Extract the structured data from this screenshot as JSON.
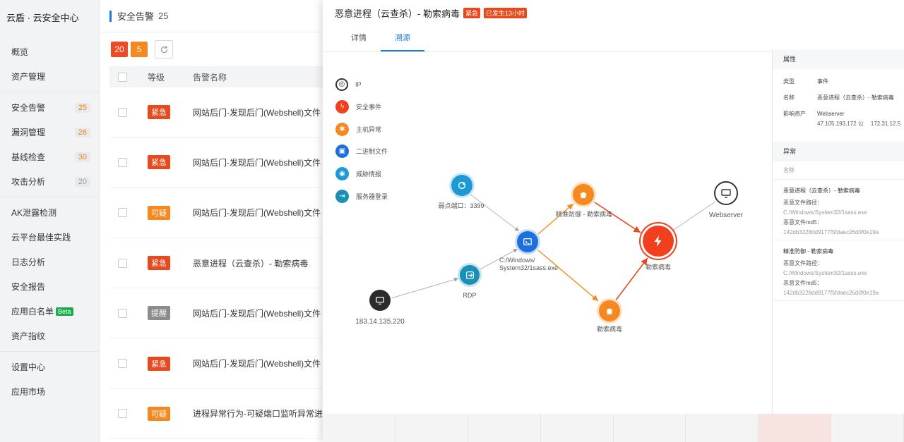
{
  "brand": "云盾 · 云安全中心",
  "nav": [
    [
      {
        "key": "overview",
        "label": "概览"
      },
      {
        "key": "assets",
        "label": "资产管理"
      }
    ],
    [
      {
        "key": "alerts",
        "label": "安全告警",
        "badge": "25"
      },
      {
        "key": "vulns",
        "label": "漏洞管理",
        "badge": "28"
      },
      {
        "key": "baseline",
        "label": "基线检查",
        "badge": "30"
      },
      {
        "key": "attack",
        "label": "攻击分析",
        "badge": "20",
        "badge_style": "gray"
      }
    ],
    [
      {
        "key": "ak",
        "label": "AK泄露检测"
      },
      {
        "key": "cloud-best",
        "label": "云平台最佳实践"
      },
      {
        "key": "logs",
        "label": "日志分析"
      },
      {
        "key": "report",
        "label": "安全报告"
      },
      {
        "key": "whitelist",
        "label": "应用白名单",
        "beta": "Beta"
      },
      {
        "key": "fingerprint",
        "label": "资产指纹"
      }
    ],
    [
      {
        "key": "settings",
        "label": "设置中心"
      },
      {
        "key": "market",
        "label": "应用市场"
      }
    ]
  ],
  "main": {
    "title": "安全告警",
    "count": "25",
    "chip_red": "20",
    "chip_orange": "5",
    "col_level": "等级",
    "col_name": "告警名称",
    "rows": [
      {
        "level": "紧急",
        "style": "urgent",
        "name": "网站后门-发现后门(Webshell)文件"
      },
      {
        "level": "紧急",
        "style": "urgent",
        "name": "网站后门-发现后门(Webshell)文件"
      },
      {
        "level": "可疑",
        "style": "suspect",
        "name": "网站后门-发现后门(Webshell)文件"
      },
      {
        "level": "紧急",
        "style": "urgent",
        "name": "恶意进程（云查杀）- 勒索病毒"
      },
      {
        "level": "提醒",
        "style": "notice",
        "name": "网站后门-发现后门(Webshell)文件"
      },
      {
        "level": "紧急",
        "style": "urgent",
        "name": "网站后门-发现后门(Webshell)文件"
      },
      {
        "level": "可疑",
        "style": "suspect",
        "name": "进程异常行为-可疑端口监听异常进程"
      }
    ]
  },
  "drawer": {
    "title": "恶意进程（云查杀）- 勒索病毒",
    "tag_urgent": "紧急",
    "tag_time": "已发生13小时",
    "tabs": [
      {
        "label": "详情"
      },
      {
        "label": "溯源",
        "active": true
      }
    ],
    "legend": [
      {
        "label": "IP",
        "style": "li-ip",
        "glyph": "◎"
      },
      {
        "label": "安全事件",
        "style": "li-event",
        "glyph": "ϟ"
      },
      {
        "label": "主机异常",
        "style": "li-host",
        "glyph": "✱"
      },
      {
        "label": "二进制文件",
        "style": "li-bin",
        "glyph": "▣"
      },
      {
        "label": "威胁情报",
        "style": "li-threat",
        "glyph": "◉"
      },
      {
        "label": "服务器登录",
        "style": "li-login",
        "glyph": "⇥"
      }
    ],
    "nodes": {
      "weak_port": "弱点端口：3399",
      "rdp": "RDP",
      "ip": "183.14.135.220",
      "binary_line1": "C:/Windows/",
      "binary_line2": "System32/1sass.exe",
      "precise": "精准防御 - 勒索病毒",
      "ransom_lower": "勒索病毒",
      "event": "勒索病毒",
      "webserver": "Webserver"
    }
  },
  "props": {
    "section_attr": "属性",
    "type_k": "类型",
    "type_v": "事件",
    "name_k": "名称",
    "name_v": "恶意进程（云查杀）- 勒索病毒",
    "asset_k": "影响资产",
    "asset_v": "Webserver",
    "asset_ip1": "47.105.193.172 公",
    "asset_ip2": "172.31.12.5",
    "section_anom": "异常",
    "anom_head": "名称",
    "anoms": [
      {
        "title": "恶意进程（云查杀）- 勒索病毒",
        "path_label": "恶意文件路径：",
        "path": "C:/Windows/System32/1sass.exe",
        "md5_label": "恶意文件md5：",
        "md5": "142db3228dd9177f5fdaec26d0f0e19a"
      },
      {
        "title": "精准防御 - 勒索病毒",
        "path_label": "恶意文件路径：",
        "path": "C:/Windows/System32/1sass.exe",
        "md5_label": "恶意文件md5：",
        "md5": "142db3228dd9177f5fdaec26d0f0e19a"
      }
    ]
  },
  "colors": {
    "accent": "#1c7cd6",
    "urgent": "#e8491d",
    "suspect": "#f5891f",
    "event": "#f0401d"
  }
}
